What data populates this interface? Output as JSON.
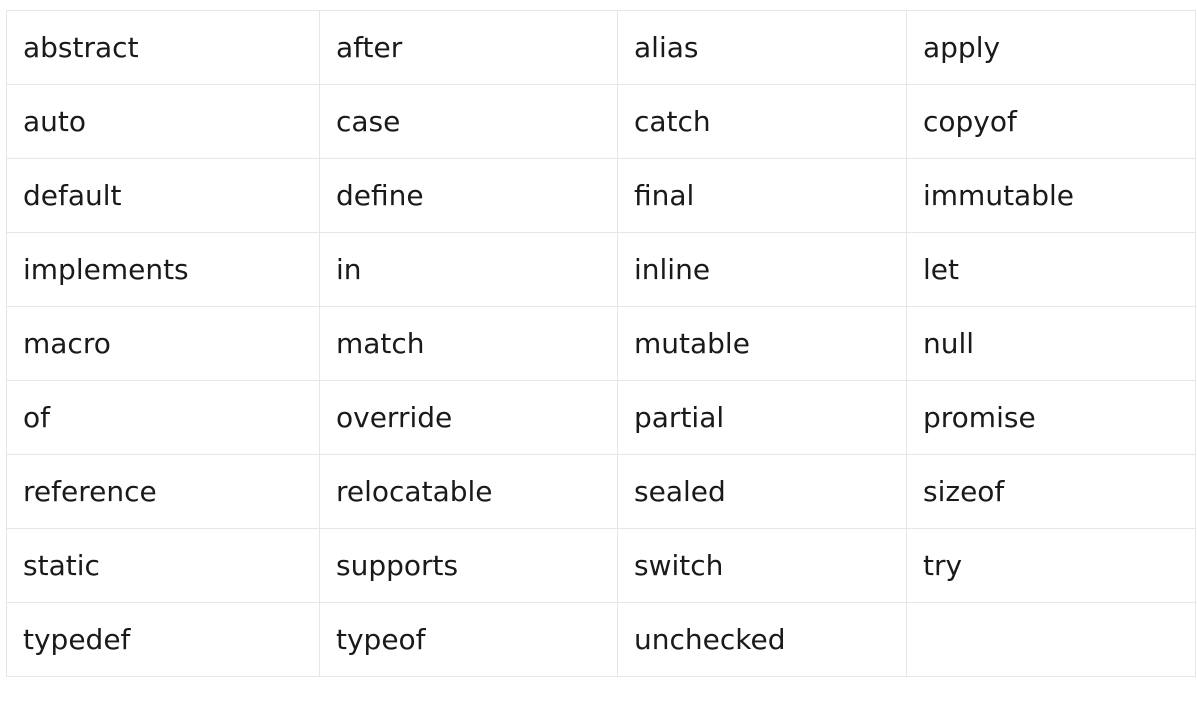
{
  "table": {
    "rows": [
      [
        "abstract",
        "after",
        "alias",
        "apply"
      ],
      [
        "auto",
        "case",
        "catch",
        "copyof"
      ],
      [
        "default",
        "define",
        "final",
        "immutable"
      ],
      [
        "implements",
        "in",
        "inline",
        "let"
      ],
      [
        "macro",
        "match",
        "mutable",
        "null"
      ],
      [
        "of",
        "override",
        "partial",
        "promise"
      ],
      [
        "reference",
        "relocatable",
        "sealed",
        "sizeof"
      ],
      [
        "static",
        "supports",
        "switch",
        "try"
      ],
      [
        "typedef",
        "typeof",
        "unchecked",
        ""
      ]
    ]
  }
}
